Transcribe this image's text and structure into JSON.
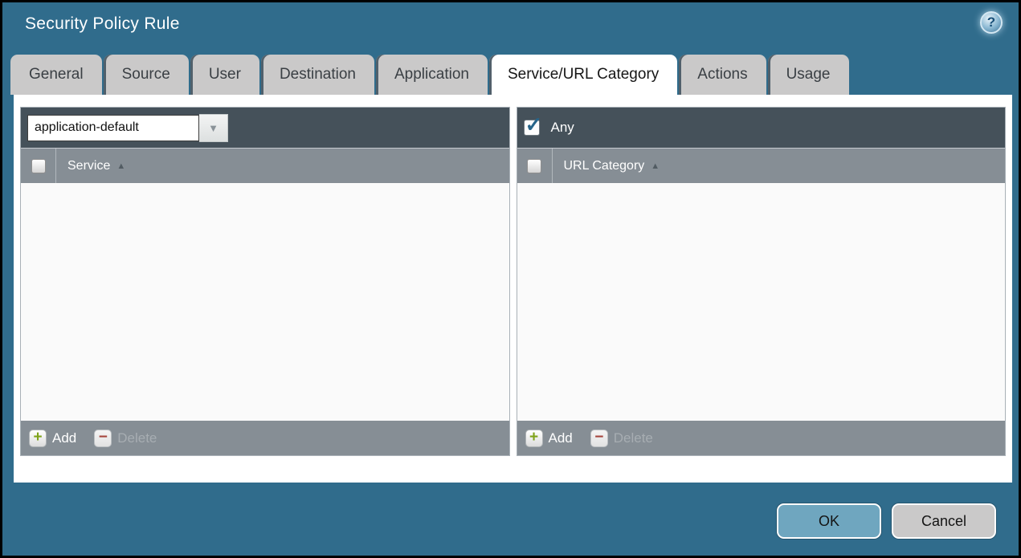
{
  "window": {
    "title": "Security Policy Rule"
  },
  "icons": {
    "help": "?",
    "dropdown": "▼",
    "sort_asc": "▲",
    "plus": "+",
    "minus": "−",
    "check": "✓"
  },
  "tabs": [
    {
      "label": "General",
      "active": false
    },
    {
      "label": "Source",
      "active": false
    },
    {
      "label": "User",
      "active": false
    },
    {
      "label": "Destination",
      "active": false
    },
    {
      "label": "Application",
      "active": false
    },
    {
      "label": "Service/URL Category",
      "active": true
    },
    {
      "label": "Actions",
      "active": false
    },
    {
      "label": "Usage",
      "active": false
    }
  ],
  "service_panel": {
    "type_dropdown": {
      "value": "application-default"
    },
    "header_checkbox_checked": false,
    "column_header": "Service",
    "rows": [],
    "add_label": "Add",
    "delete_label": "Delete",
    "delete_disabled": true
  },
  "url_category_panel": {
    "any_label": "Any",
    "any_checked": true,
    "header_checkbox_checked": false,
    "column_header": "URL Category",
    "rows": [],
    "add_label": "Add",
    "delete_label": "Delete",
    "delete_disabled": true
  },
  "buttons": {
    "ok": "OK",
    "cancel": "Cancel"
  },
  "colors": {
    "titlebar_teal": "#306c8c",
    "toolbar_dark": "#45515a",
    "header_gray": "#868e95",
    "tab_inactive": "#cac9c9",
    "ok_button": "#6fa6bf",
    "add_green": "#7fa31a",
    "delete_red": "#a6453d",
    "check_blue": "#27658a"
  }
}
